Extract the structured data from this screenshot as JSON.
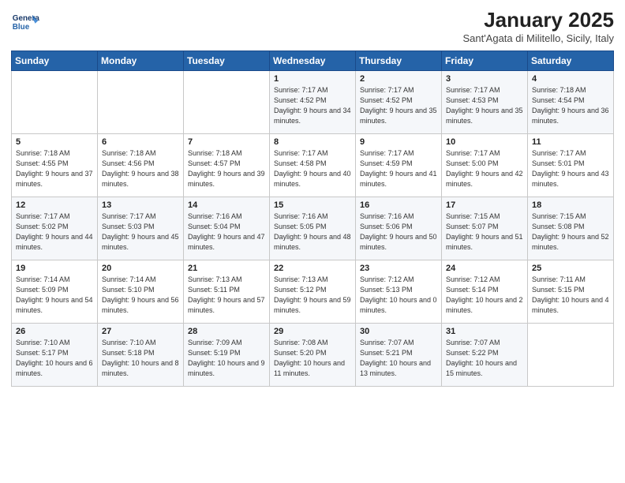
{
  "header": {
    "logo_line1": "General",
    "logo_line2": "Blue",
    "title": "January 2025",
    "subtitle": "Sant'Agata di Militello, Sicily, Italy"
  },
  "weekdays": [
    "Sunday",
    "Monday",
    "Tuesday",
    "Wednesday",
    "Thursday",
    "Friday",
    "Saturday"
  ],
  "weeks": [
    [
      {
        "day": "",
        "sunrise": "",
        "sunset": "",
        "daylight": ""
      },
      {
        "day": "",
        "sunrise": "",
        "sunset": "",
        "daylight": ""
      },
      {
        "day": "",
        "sunrise": "",
        "sunset": "",
        "daylight": ""
      },
      {
        "day": "1",
        "sunrise": "Sunrise: 7:17 AM",
        "sunset": "Sunset: 4:52 PM",
        "daylight": "Daylight: 9 hours and 34 minutes."
      },
      {
        "day": "2",
        "sunrise": "Sunrise: 7:17 AM",
        "sunset": "Sunset: 4:52 PM",
        "daylight": "Daylight: 9 hours and 35 minutes."
      },
      {
        "day": "3",
        "sunrise": "Sunrise: 7:17 AM",
        "sunset": "Sunset: 4:53 PM",
        "daylight": "Daylight: 9 hours and 35 minutes."
      },
      {
        "day": "4",
        "sunrise": "Sunrise: 7:18 AM",
        "sunset": "Sunset: 4:54 PM",
        "daylight": "Daylight: 9 hours and 36 minutes."
      }
    ],
    [
      {
        "day": "5",
        "sunrise": "Sunrise: 7:18 AM",
        "sunset": "Sunset: 4:55 PM",
        "daylight": "Daylight: 9 hours and 37 minutes."
      },
      {
        "day": "6",
        "sunrise": "Sunrise: 7:18 AM",
        "sunset": "Sunset: 4:56 PM",
        "daylight": "Daylight: 9 hours and 38 minutes."
      },
      {
        "day": "7",
        "sunrise": "Sunrise: 7:18 AM",
        "sunset": "Sunset: 4:57 PM",
        "daylight": "Daylight: 9 hours and 39 minutes."
      },
      {
        "day": "8",
        "sunrise": "Sunrise: 7:17 AM",
        "sunset": "Sunset: 4:58 PM",
        "daylight": "Daylight: 9 hours and 40 minutes."
      },
      {
        "day": "9",
        "sunrise": "Sunrise: 7:17 AM",
        "sunset": "Sunset: 4:59 PM",
        "daylight": "Daylight: 9 hours and 41 minutes."
      },
      {
        "day": "10",
        "sunrise": "Sunrise: 7:17 AM",
        "sunset": "Sunset: 5:00 PM",
        "daylight": "Daylight: 9 hours and 42 minutes."
      },
      {
        "day": "11",
        "sunrise": "Sunrise: 7:17 AM",
        "sunset": "Sunset: 5:01 PM",
        "daylight": "Daylight: 9 hours and 43 minutes."
      }
    ],
    [
      {
        "day": "12",
        "sunrise": "Sunrise: 7:17 AM",
        "sunset": "Sunset: 5:02 PM",
        "daylight": "Daylight: 9 hours and 44 minutes."
      },
      {
        "day": "13",
        "sunrise": "Sunrise: 7:17 AM",
        "sunset": "Sunset: 5:03 PM",
        "daylight": "Daylight: 9 hours and 45 minutes."
      },
      {
        "day": "14",
        "sunrise": "Sunrise: 7:16 AM",
        "sunset": "Sunset: 5:04 PM",
        "daylight": "Daylight: 9 hours and 47 minutes."
      },
      {
        "day": "15",
        "sunrise": "Sunrise: 7:16 AM",
        "sunset": "Sunset: 5:05 PM",
        "daylight": "Daylight: 9 hours and 48 minutes."
      },
      {
        "day": "16",
        "sunrise": "Sunrise: 7:16 AM",
        "sunset": "Sunset: 5:06 PM",
        "daylight": "Daylight: 9 hours and 50 minutes."
      },
      {
        "day": "17",
        "sunrise": "Sunrise: 7:15 AM",
        "sunset": "Sunset: 5:07 PM",
        "daylight": "Daylight: 9 hours and 51 minutes."
      },
      {
        "day": "18",
        "sunrise": "Sunrise: 7:15 AM",
        "sunset": "Sunset: 5:08 PM",
        "daylight": "Daylight: 9 hours and 52 minutes."
      }
    ],
    [
      {
        "day": "19",
        "sunrise": "Sunrise: 7:14 AM",
        "sunset": "Sunset: 5:09 PM",
        "daylight": "Daylight: 9 hours and 54 minutes."
      },
      {
        "day": "20",
        "sunrise": "Sunrise: 7:14 AM",
        "sunset": "Sunset: 5:10 PM",
        "daylight": "Daylight: 9 hours and 56 minutes."
      },
      {
        "day": "21",
        "sunrise": "Sunrise: 7:13 AM",
        "sunset": "Sunset: 5:11 PM",
        "daylight": "Daylight: 9 hours and 57 minutes."
      },
      {
        "day": "22",
        "sunrise": "Sunrise: 7:13 AM",
        "sunset": "Sunset: 5:12 PM",
        "daylight": "Daylight: 9 hours and 59 minutes."
      },
      {
        "day": "23",
        "sunrise": "Sunrise: 7:12 AM",
        "sunset": "Sunset: 5:13 PM",
        "daylight": "Daylight: 10 hours and 0 minutes."
      },
      {
        "day": "24",
        "sunrise": "Sunrise: 7:12 AM",
        "sunset": "Sunset: 5:14 PM",
        "daylight": "Daylight: 10 hours and 2 minutes."
      },
      {
        "day": "25",
        "sunrise": "Sunrise: 7:11 AM",
        "sunset": "Sunset: 5:15 PM",
        "daylight": "Daylight: 10 hours and 4 minutes."
      }
    ],
    [
      {
        "day": "26",
        "sunrise": "Sunrise: 7:10 AM",
        "sunset": "Sunset: 5:17 PM",
        "daylight": "Daylight: 10 hours and 6 minutes."
      },
      {
        "day": "27",
        "sunrise": "Sunrise: 7:10 AM",
        "sunset": "Sunset: 5:18 PM",
        "daylight": "Daylight: 10 hours and 8 minutes."
      },
      {
        "day": "28",
        "sunrise": "Sunrise: 7:09 AM",
        "sunset": "Sunset: 5:19 PM",
        "daylight": "Daylight: 10 hours and 9 minutes."
      },
      {
        "day": "29",
        "sunrise": "Sunrise: 7:08 AM",
        "sunset": "Sunset: 5:20 PM",
        "daylight": "Daylight: 10 hours and 11 minutes."
      },
      {
        "day": "30",
        "sunrise": "Sunrise: 7:07 AM",
        "sunset": "Sunset: 5:21 PM",
        "daylight": "Daylight: 10 hours and 13 minutes."
      },
      {
        "day": "31",
        "sunrise": "Sunrise: 7:07 AM",
        "sunset": "Sunset: 5:22 PM",
        "daylight": "Daylight: 10 hours and 15 minutes."
      },
      {
        "day": "",
        "sunrise": "",
        "sunset": "",
        "daylight": ""
      }
    ]
  ]
}
